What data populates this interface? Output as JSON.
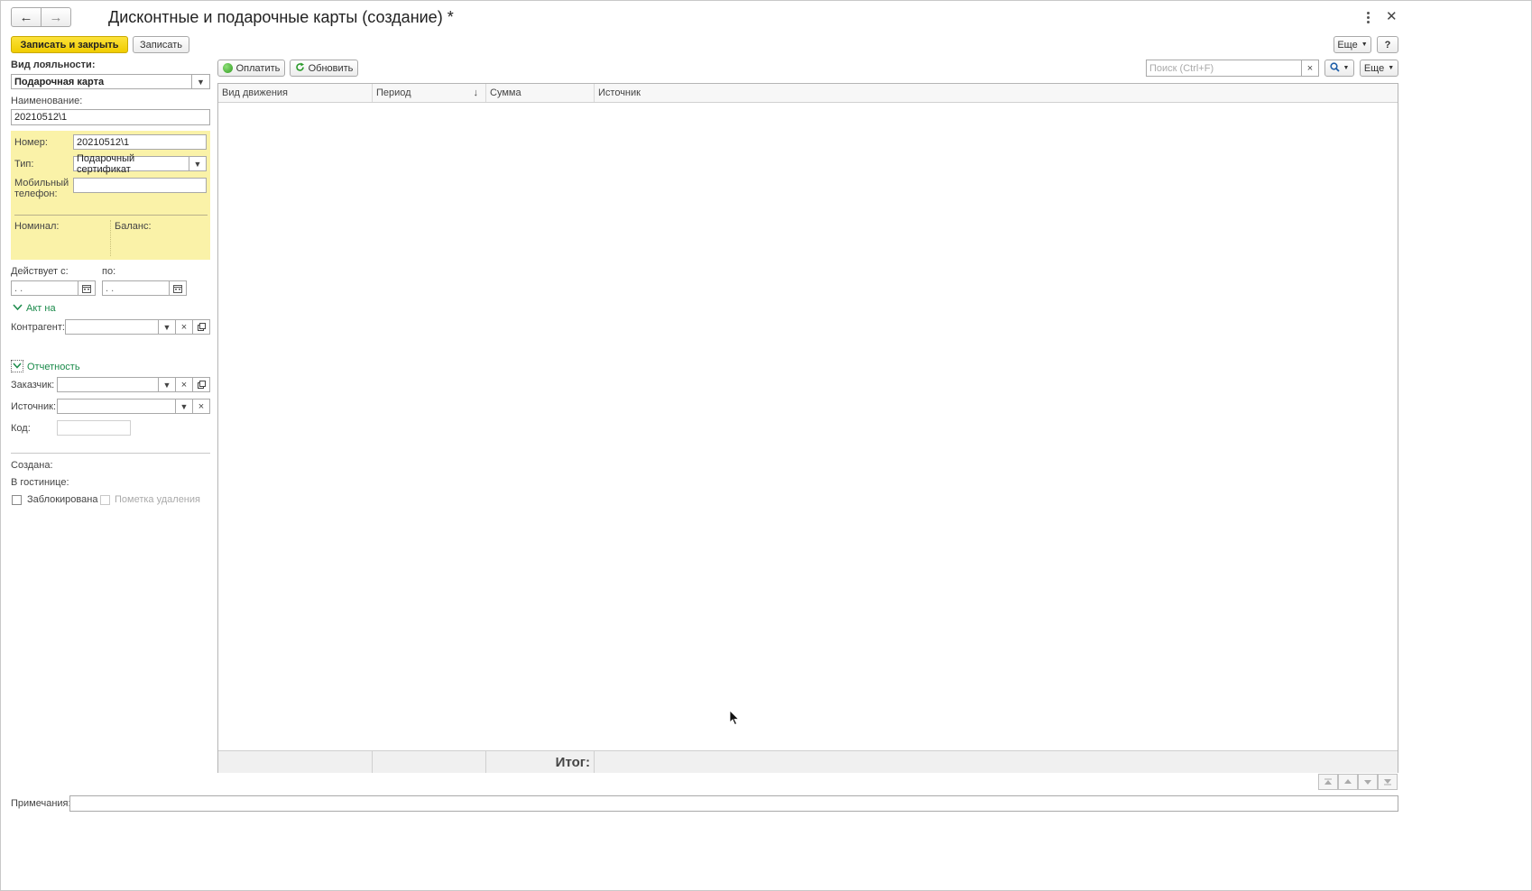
{
  "window": {
    "title": "Дисконтные и подарочные карты (создание) *",
    "nav_back": "←",
    "nav_forward": "→",
    "menu_icon": "kebab-menu-icon",
    "close_icon": "close-icon"
  },
  "toolbar": {
    "save_close_label": "Записать и закрыть",
    "save_label": "Записать",
    "more_label": "Еще",
    "help_label": "?"
  },
  "form": {
    "loyalty_type_label": "Вид лояльности:",
    "loyalty_type_value": "Подарочная карта",
    "name_label": "Наименование:",
    "name_value": "20210512\\1",
    "number_label": "Номер:",
    "number_value": "20210512\\1",
    "type_label": "Тип:",
    "type_value": "Подарочный сертификат",
    "phone_label_1": "Мобильный",
    "phone_label_2": "телефон:",
    "phone_value": "",
    "nominal_label": "Номинал:",
    "balance_label": "Баланс:",
    "valid_from_label": "Действует с:",
    "valid_to_label": "по:",
    "valid_from_value": " .  .",
    "valid_to_value": " .  .",
    "act_group_label": "Акт на",
    "counterparty_label": "Контрагент:",
    "reporting_group_label": "Отчетность",
    "customer_label": "Заказчик:",
    "source_label": "Источник:",
    "code_label": "Код:",
    "created_label": "Создана:",
    "hotel_label": "В гостинице:",
    "blocked_label": "Заблокирована",
    "deletion_mark_label": "Пометка удаления",
    "notes_label": "Примечания:"
  },
  "table_toolbar": {
    "pay_label": "Оплатить",
    "refresh_label": "Обновить",
    "search_placeholder": "Поиск (Ctrl+F)",
    "more_label": "Еще"
  },
  "table": {
    "columns": [
      "Вид движения",
      "Период",
      "Сумма",
      "Источник"
    ],
    "sort_indicator": "↓",
    "rows": [],
    "total_label": "Итог:"
  },
  "colors": {
    "accent_yellow": "#f5d417",
    "panel_yellow": "#faf2a8",
    "link_green": "#1a8a4a"
  }
}
